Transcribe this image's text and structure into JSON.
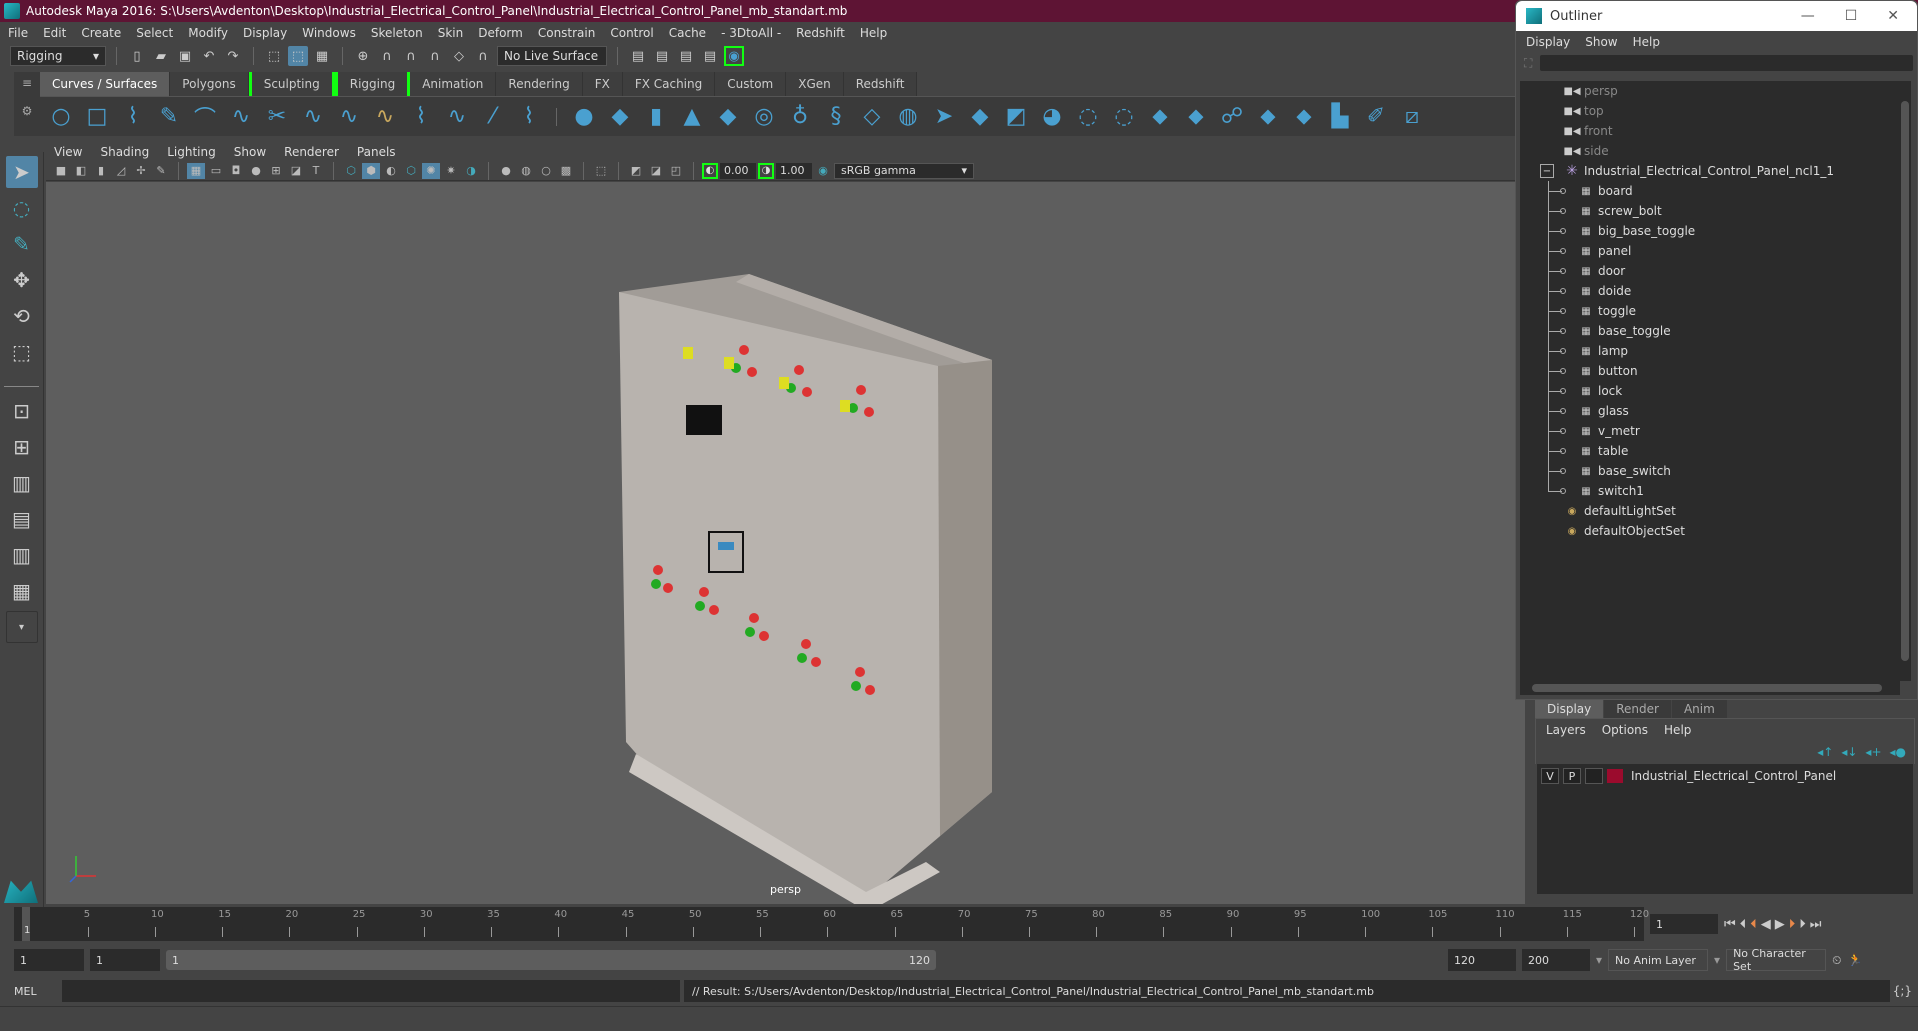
{
  "title": "Autodesk Maya 2016: S:\\Users\\Avdenton\\Desktop\\Industrial_Electrical_Control_Panel\\Industrial_Electrical_Control_Panel_mb_standart.mb",
  "menu": [
    "File",
    "Edit",
    "Create",
    "Select",
    "Modify",
    "Display",
    "Windows",
    "Skeleton",
    "Skin",
    "Deform",
    "Constrain",
    "Control",
    "Cache",
    "- 3DtoAll -",
    "Redshift",
    "Help"
  ],
  "status": {
    "mode": "Rigging",
    "live_surface": "No Live Surface"
  },
  "shelf_tabs": [
    "Curves / Surfaces",
    "Polygons",
    "Sculpting",
    "Rigging",
    "Animation",
    "Rendering",
    "FX",
    "FX Caching",
    "Custom",
    "XGen",
    "Redshift"
  ],
  "viewport": {
    "menu": [
      "View",
      "Shading",
      "Lighting",
      "Show",
      "Renderer",
      "Panels"
    ],
    "exposure": "0.00",
    "gamma": "1.00",
    "color_space": "sRGB gamma",
    "camera_label": "persp"
  },
  "outliner": {
    "title": "Outliner",
    "menu": [
      "Display",
      "Show",
      "Help"
    ],
    "cameras": [
      "persp",
      "top",
      "front",
      "side"
    ],
    "group": "Industrial_Electrical_Control_Panel_ncl1_1",
    "children": [
      "board",
      "screw_bolt",
      "big_base_toggle",
      "panel",
      "door",
      "doide",
      "toggle",
      "base_toggle",
      "lamp",
      "button",
      "lock",
      "glass",
      "v_metr",
      "table",
      "base_switch",
      "switch1"
    ],
    "sets": [
      "defaultLightSet",
      "defaultObjectSet"
    ]
  },
  "layers": {
    "tabs": [
      "Display",
      "Render",
      "Anim"
    ],
    "menu": [
      "Layers",
      "Options",
      "Help"
    ],
    "rows": [
      {
        "v": "V",
        "p": "P",
        "name": "Industrial_Electrical_Control_Panel",
        "color": "#9b0b2d"
      }
    ]
  },
  "timeline": {
    "ticks": [
      "5",
      "10",
      "15",
      "20",
      "25",
      "30",
      "35",
      "40",
      "45",
      "50",
      "55",
      "60",
      "65",
      "70",
      "75",
      "80",
      "85",
      "90",
      "95",
      "100",
      "105",
      "110",
      "115",
      "120"
    ],
    "start_marker": "1",
    "current_frame": "1"
  },
  "range": {
    "start": "1",
    "anim_start": "1",
    "slider_start": "1",
    "slider_end": "120",
    "end": "120",
    "anim_end": "200",
    "anim_layer": "No Anim Layer",
    "char_set": "No Character Set"
  },
  "cmd": {
    "lang": "MEL",
    "result": "// Result: S:/Users/Avdenton/Desktop/Industrial_Electrical_Control_Panel/Industrial_Electrical_Control_Panel_mb_standart.mb"
  }
}
